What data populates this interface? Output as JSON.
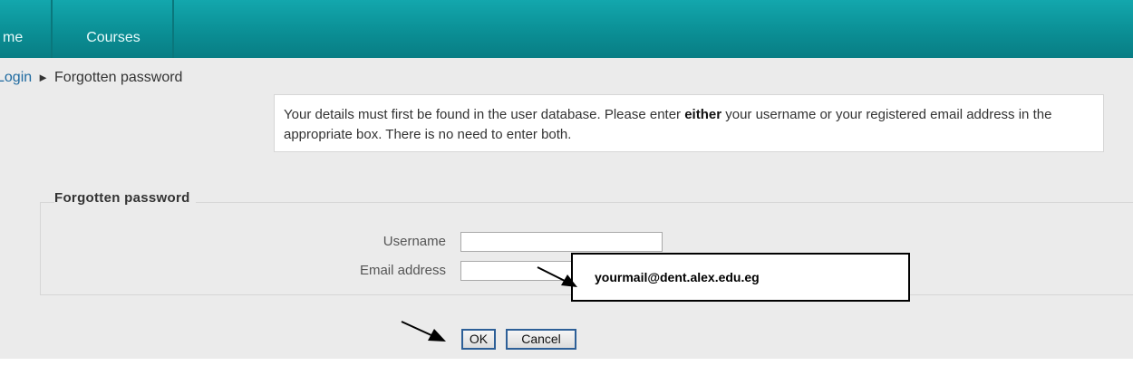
{
  "nav": {
    "home_label": "me",
    "courses_label": "Courses"
  },
  "breadcrumb": {
    "login": "Login",
    "separator": "►",
    "current": "Forgotten password"
  },
  "notice": {
    "part1": "Your details must first be found in the user database. Please enter ",
    "emphasis": "either",
    "part2": " your username or your registered email address in the appropriate box. There is no need to enter both."
  },
  "form": {
    "legend": "Forgotten password",
    "username_label": "Username",
    "username_value": "",
    "email_label": "Email address",
    "email_value": ""
  },
  "callout": {
    "text": "yourmail@dent.alex.edu.eg"
  },
  "buttons": {
    "ok": "OK",
    "cancel": "Cancel"
  },
  "colors": {
    "navbar": "#0b8f95",
    "link": "#1e6aa0",
    "page_background": "#ebebeb"
  }
}
